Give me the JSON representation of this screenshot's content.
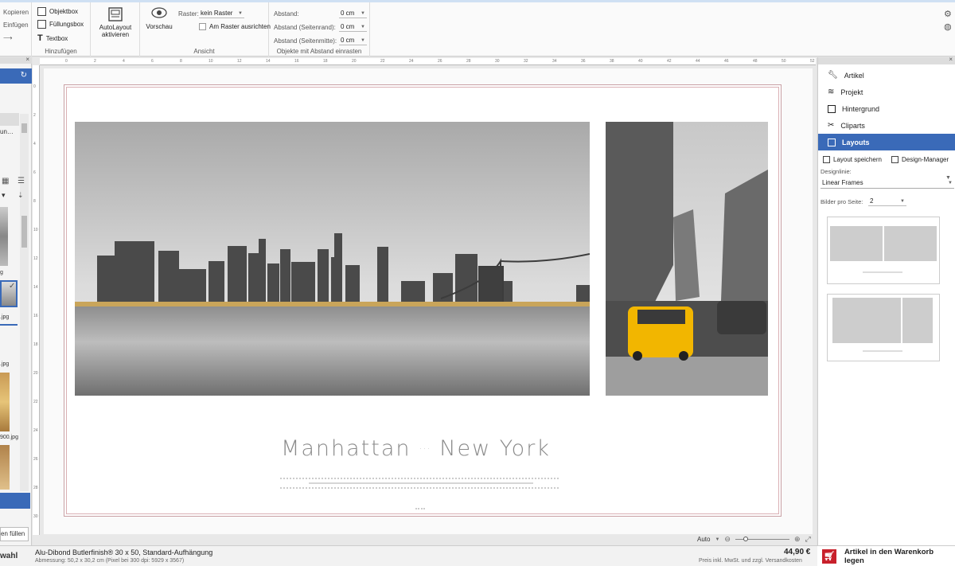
{
  "ribbon": {
    "clipboard": {
      "copy": "Kopieren",
      "paste": "Einfügen"
    },
    "add_group": {
      "title": "Hinzufügen",
      "object_box": "Objektbox",
      "fill_box": "Füllungsbox",
      "text_box": "Textbox"
    },
    "autolayout": {
      "label_line1": "AutoLayout",
      "label_line2": "aktivieren"
    },
    "view_group": {
      "title": "Ansicht",
      "preview": "Vorschau",
      "grid_label": "Raster:",
      "grid_value": "kein Raster",
      "snap_label": "Am Raster ausrichten"
    },
    "spacing_group": {
      "title": "Objekte mit Abstand einrasten",
      "spacing_label": "Abstand:",
      "spacing_value": "0 cm",
      "edge_label": "Abstand (Seitenrand):",
      "edge_value": "0 cm",
      "center_label": "Abstand (Seitenmitte):",
      "center_value": "0 cm"
    }
  },
  "left_panel": {
    "item_fragment": "un…",
    "file1": "g",
    "file2": ".jpg",
    "file3": "900.jpg",
    "fill_button": "en füllen",
    "selection": "wahl"
  },
  "ruler_ticks": [
    "0",
    "2",
    "4",
    "6",
    "8",
    "10",
    "12",
    "14",
    "16",
    "18",
    "20",
    "22",
    "24",
    "26",
    "28",
    "30",
    "32",
    "34",
    "36",
    "38",
    "40",
    "42",
    "44",
    "46",
    "48",
    "50",
    "52"
  ],
  "ruler_v_ticks": [
    "0",
    "2",
    "4",
    "6",
    "8",
    "10",
    "12",
    "14",
    "16",
    "18",
    "20",
    "22",
    "24",
    "26",
    "28",
    "30"
  ],
  "canvas": {
    "title_left": "Manhattan",
    "title_sep": "···",
    "title_right": "New York",
    "zoom_mode": "Auto"
  },
  "right_panel": {
    "nav": [
      {
        "label": "Artikel",
        "icon": "wrench-icon"
      },
      {
        "label": "Projekt",
        "icon": "layers-icon"
      },
      {
        "label": "Hintergrund",
        "icon": "background-icon"
      },
      {
        "label": "Cliparts",
        "icon": "clipart-icon"
      },
      {
        "label": "Layouts",
        "icon": "layout-icon",
        "active": true
      }
    ],
    "save_layout": "Layout speichern",
    "design_manager": "Design-Manager",
    "design_line_label": "Designlinie:",
    "design_line_value": "Linear Frames",
    "images_per_page_label": "Bilder pro Seite:",
    "images_per_page_value": "2"
  },
  "status": {
    "product": "Alu-Dibond Butlerfinish® 30 x 50, Standard-Aufhängung",
    "dimensions": "Abmessung: 50,2 x 30,2 cm (Pixel bei 300 dpi: 5929 x 3567)",
    "price": "44,90 €",
    "price_note": "Preis inkl. MwSt. und zzgl. Versandkosten",
    "cart_button": "Artikel in den Warenkorb legen"
  },
  "colors": {
    "accent": "#3a6ab8",
    "cart_red": "#c8202b",
    "taxi": "#f2b600"
  }
}
